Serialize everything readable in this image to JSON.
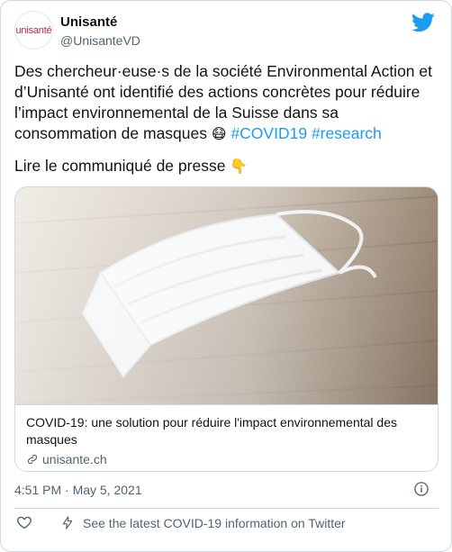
{
  "author": {
    "name": "Unisanté",
    "handle": "@UnisanteVD",
    "avatar_text": "unisanté"
  },
  "tweet": {
    "text_main": "Des chercheur·euse·s de la société Environmental Action et d’Unisanté ont identifié des actions concrètes pour réduire l’impact environnemental de la Suisse dans sa consommation de masques",
    "emoji_mask": "😷",
    "hashtag_1": "#COVID19",
    "hashtag_2": "#research",
    "cta_text": "Lire le communiqué de presse",
    "emoji_point": "👇"
  },
  "link_card": {
    "title": "COVID-19: une solution pour réduire l'impact environnemental des masques",
    "domain": "unisante.ch"
  },
  "meta": {
    "timestamp": "4:51 PM · May 5, 2021"
  },
  "footer": {
    "covid_info": "See the latest COVID-19 information on Twitter"
  },
  "colors": {
    "accent": "#1d9bf0",
    "text_primary": "#0f1419",
    "text_secondary": "#536471",
    "border": "#cfd9de"
  },
  "icons": [
    "twitter-bird-icon",
    "link-icon",
    "info-icon",
    "heart-icon",
    "lightning-icon"
  ]
}
